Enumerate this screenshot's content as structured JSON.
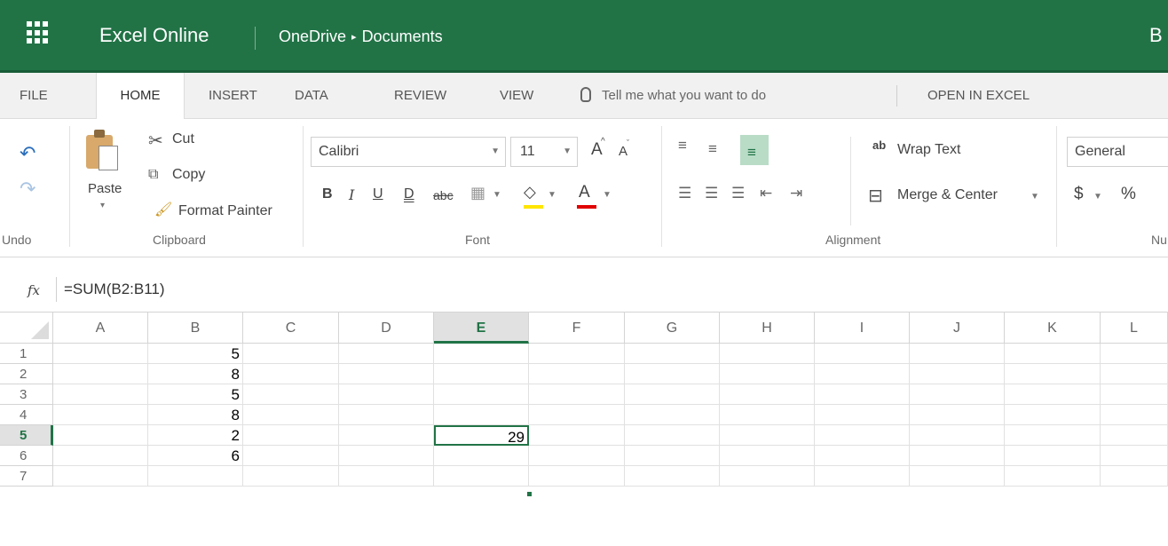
{
  "titlebar": {
    "app_title": "Excel Online",
    "breadcrumb": [
      "OneDrive",
      "Documents"
    ],
    "breadcrumb_sep": "▸",
    "user_initial": "B",
    "colors": {
      "bar": "#217346"
    }
  },
  "menu": {
    "tabs": [
      "FILE",
      "HOME",
      "INSERT",
      "DATA",
      "REVIEW",
      "VIEW"
    ],
    "active_tab": "HOME",
    "tell_me": "Tell me what you want to do",
    "open_in_excel": "OPEN IN EXCEL"
  },
  "ribbon": {
    "undo": {
      "label": "Undo",
      "undo_icon": "undo-icon",
      "redo_icon": "redo-icon"
    },
    "clipboard": {
      "label": "Clipboard",
      "paste": "Paste",
      "cut": "Cut",
      "copy": "Copy",
      "format_painter": "Format Painter"
    },
    "font": {
      "label": "Font",
      "family": "Calibri",
      "size": "11",
      "grow": "A",
      "shrink": "A",
      "bold": "B",
      "italic": "I",
      "underline": "U",
      "double_underline": "D",
      "strikethrough": "abc",
      "font_color_letter": "A"
    },
    "alignment": {
      "label": "Alignment",
      "wrap_text": "Wrap Text",
      "merge_center": "Merge & Center",
      "wrap_glyph": "ab"
    },
    "number": {
      "label": "Nu",
      "format": "General",
      "currency": "$",
      "percent": "%"
    }
  },
  "formula_bar": {
    "fx": "fx",
    "formula": "=SUM(B2:B11)"
  },
  "sheet": {
    "columns": [
      "A",
      "B",
      "C",
      "D",
      "E",
      "F",
      "G",
      "H",
      "I",
      "J",
      "K",
      "L"
    ],
    "selected_column": "E",
    "rows": [
      {
        "num": "1",
        "b": "5",
        "e": ""
      },
      {
        "num": "2",
        "b": "8",
        "e": ""
      },
      {
        "num": "3",
        "b": "5",
        "e": ""
      },
      {
        "num": "4",
        "b": "8",
        "e": ""
      },
      {
        "num": "5",
        "b": "2",
        "e": "29"
      },
      {
        "num": "6",
        "b": "6",
        "e": ""
      },
      {
        "num": "7",
        "b": "",
        "e": ""
      }
    ],
    "selected_row": "5",
    "active_cell": "E5"
  }
}
